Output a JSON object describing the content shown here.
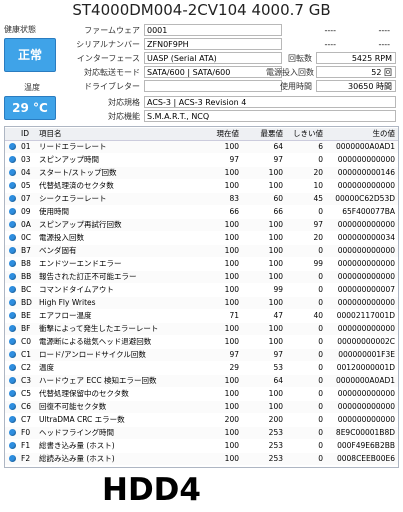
{
  "title": "ST4000DM004-2CV104 4000.7 GB",
  "health": {
    "label": "健康状態",
    "status": "正常",
    "color": "#3fa3e8"
  },
  "temperature": {
    "label": "温度",
    "value": "29 °C"
  },
  "info_left": [
    {
      "label": "ファームウェア",
      "value": "0001"
    },
    {
      "label": "シリアルナンバー",
      "value": "ZFN0F9PH"
    },
    {
      "label": "インターフェース",
      "value": "UASP (Serial ATA)"
    },
    {
      "label": "対応転送モード",
      "value": "SATA/600 | SATA/600"
    },
    {
      "label": "ドライブレター",
      "value": ""
    }
  ],
  "info_right": [
    {
      "label": "",
      "value": "----",
      "extra": "----"
    },
    {
      "label": "",
      "value": "----",
      "extra": "----"
    },
    {
      "label": "回転数",
      "value": "5425 RPM"
    },
    {
      "label": "電源投入回数",
      "value": "52 回"
    },
    {
      "label": "使用時間",
      "value": "30650 時間"
    }
  ],
  "standard": {
    "label": "対応規格",
    "value": "ACS-3 | ACS-3 Revision 4"
  },
  "features": {
    "label": "対応機能",
    "value": "S.M.A.R.T., NCQ"
  },
  "table": {
    "headers": {
      "id": "ID",
      "name": "項目名",
      "current": "現在値",
      "worst": "最悪値",
      "threshold": "しきい値",
      "raw": "生の値"
    },
    "rows": [
      {
        "id": "01",
        "name": "リードエラーレート",
        "current": "100",
        "worst": "64",
        "threshold": "6",
        "raw": "0000000A0AD1"
      },
      {
        "id": "03",
        "name": "スピンアップ時間",
        "current": "97",
        "worst": "97",
        "threshold": "0",
        "raw": "000000000000"
      },
      {
        "id": "04",
        "name": "スタート/ストップ回数",
        "current": "100",
        "worst": "100",
        "threshold": "20",
        "raw": "000000000146"
      },
      {
        "id": "05",
        "name": "代替処理済のセクタ数",
        "current": "100",
        "worst": "100",
        "threshold": "10",
        "raw": "000000000000"
      },
      {
        "id": "07",
        "name": "シークエラーレート",
        "current": "83",
        "worst": "60",
        "threshold": "45",
        "raw": "00000C62D53D"
      },
      {
        "id": "09",
        "name": "使用時間",
        "current": "66",
        "worst": "66",
        "threshold": "0",
        "raw": "65F400077BA"
      },
      {
        "id": "0A",
        "name": "スピンアップ再試行回数",
        "current": "100",
        "worst": "100",
        "threshold": "97",
        "raw": "000000000000"
      },
      {
        "id": "0C",
        "name": "電源投入回数",
        "current": "100",
        "worst": "100",
        "threshold": "20",
        "raw": "000000000034"
      },
      {
        "id": "B7",
        "name": "ベンダ固有",
        "current": "100",
        "worst": "100",
        "threshold": "0",
        "raw": "000000000000"
      },
      {
        "id": "B8",
        "name": "エンドツーエンドエラー",
        "current": "100",
        "worst": "100",
        "threshold": "99",
        "raw": "000000000000"
      },
      {
        "id": "BB",
        "name": "報告された訂正不可能エラー",
        "current": "100",
        "worst": "100",
        "threshold": "0",
        "raw": "000000000000"
      },
      {
        "id": "BC",
        "name": "コマンドタイムアウト",
        "current": "100",
        "worst": "99",
        "threshold": "0",
        "raw": "000000000007"
      },
      {
        "id": "BD",
        "name": "High Fly Writes",
        "current": "100",
        "worst": "100",
        "threshold": "0",
        "raw": "000000000000"
      },
      {
        "id": "BE",
        "name": "エアフロー温度",
        "current": "71",
        "worst": "47",
        "threshold": "40",
        "raw": "00002117001D"
      },
      {
        "id": "BF",
        "name": "衝撃によって発生したエラーレート",
        "current": "100",
        "worst": "100",
        "threshold": "0",
        "raw": "000000000000"
      },
      {
        "id": "C0",
        "name": "電源断による磁気ヘッド退避回数",
        "current": "100",
        "worst": "100",
        "threshold": "0",
        "raw": "00000000002C"
      },
      {
        "id": "C1",
        "name": "ロード/アンロードサイクル回数",
        "current": "97",
        "worst": "97",
        "threshold": "0",
        "raw": "000000001F3E"
      },
      {
        "id": "C2",
        "name": "温度",
        "current": "29",
        "worst": "53",
        "threshold": "0",
        "raw": "00120000001D"
      },
      {
        "id": "C3",
        "name": "ハードウェア ECC 検知エラー回数",
        "current": "100",
        "worst": "64",
        "threshold": "0",
        "raw": "0000000A0AD1"
      },
      {
        "id": "C5",
        "name": "代替処理保留中のセクタ数",
        "current": "100",
        "worst": "100",
        "threshold": "0",
        "raw": "000000000000"
      },
      {
        "id": "C6",
        "name": "回復不可能セクタ数",
        "current": "100",
        "worst": "100",
        "threshold": "0",
        "raw": "000000000000"
      },
      {
        "id": "C7",
        "name": "UltraDMA CRC エラー数",
        "current": "200",
        "worst": "200",
        "threshold": "0",
        "raw": "000000000000"
      },
      {
        "id": "F0",
        "name": "ヘッドフライング時間",
        "current": "100",
        "worst": "253",
        "threshold": "0",
        "raw": "8E9C00001B8D"
      },
      {
        "id": "F1",
        "name": "総書き込み量 (ホスト)",
        "current": "100",
        "worst": "253",
        "threshold": "0",
        "raw": "000F49E6B2BB"
      },
      {
        "id": "F2",
        "name": "総読み込み量 (ホスト)",
        "current": "100",
        "worst": "253",
        "threshold": "0",
        "raw": "0008CEEB00E6"
      }
    ]
  },
  "footer_label": "HDD4"
}
